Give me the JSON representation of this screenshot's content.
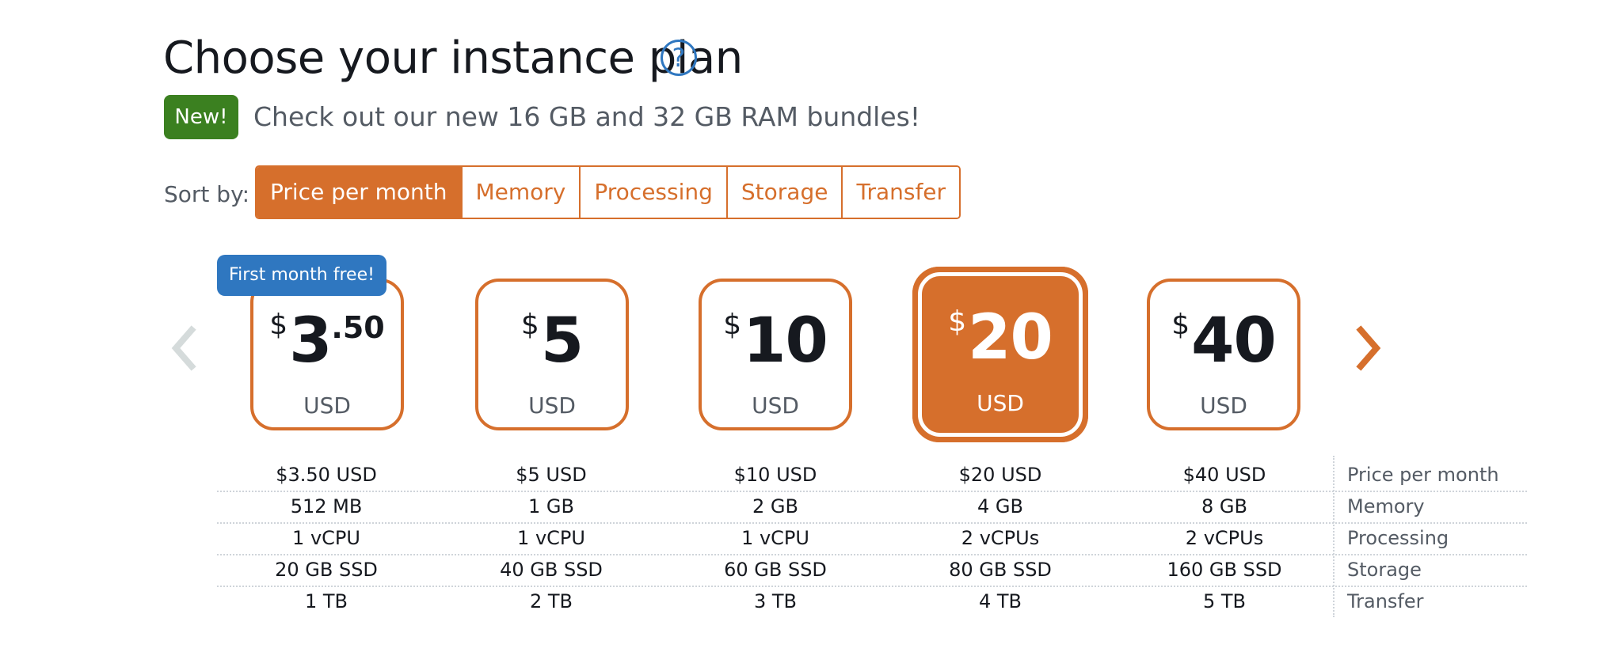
{
  "header": {
    "title": "Choose your instance plan",
    "help_icon": "question-circle-icon"
  },
  "promo": {
    "badge": "New!",
    "text": "Check out our new 16 GB and 32 GB RAM bundles!"
  },
  "sort": {
    "label": "Sort by:",
    "options": [
      "Price per month",
      "Memory",
      "Processing",
      "Storage",
      "Transfer"
    ],
    "selected": "Price per month"
  },
  "carousel": {
    "prev_icon": "chevron-left-icon",
    "next_icon": "chevron-right-icon"
  },
  "plans": [
    {
      "currency_symbol": "$",
      "amount": "3",
      "cents": ".50",
      "currency": "USD",
      "ribbon": "First month free!",
      "selected": false
    },
    {
      "currency_symbol": "$",
      "amount": "5",
      "cents": "",
      "currency": "USD",
      "selected": false
    },
    {
      "currency_symbol": "$",
      "amount": "10",
      "cents": "",
      "currency": "USD",
      "selected": false
    },
    {
      "currency_symbol": "$",
      "amount": "20",
      "cents": "",
      "currency": "USD",
      "selected": true
    },
    {
      "currency_symbol": "$",
      "amount": "40",
      "cents": "",
      "currency": "USD",
      "selected": false
    }
  ],
  "specs": {
    "rows": [
      {
        "label": "Price per month",
        "values": [
          "$3.50 USD",
          "$5 USD",
          "$10 USD",
          "$20 USD",
          "$40 USD"
        ]
      },
      {
        "label": "Memory",
        "values": [
          "512 MB",
          "1 GB",
          "2 GB",
          "4 GB",
          "8 GB"
        ]
      },
      {
        "label": "Processing",
        "values": [
          "1 vCPU",
          "1 vCPU",
          "1 vCPU",
          "2 vCPUs",
          "2 vCPUs"
        ]
      },
      {
        "label": "Storage",
        "values": [
          "20 GB SSD",
          "40 GB SSD",
          "60 GB SSD",
          "80 GB SSD",
          "160 GB SSD"
        ]
      },
      {
        "label": "Transfer",
        "values": [
          "1 TB",
          "2 TB",
          "3 TB",
          "4 TB",
          "5 TB"
        ]
      }
    ]
  },
  "colors": {
    "accent": "#d66f2c",
    "badge_green": "#3b8020",
    "ribbon_blue": "#2f77c0",
    "muted_text": "#545b64",
    "disabled_arrow": "#d5dbdb"
  }
}
